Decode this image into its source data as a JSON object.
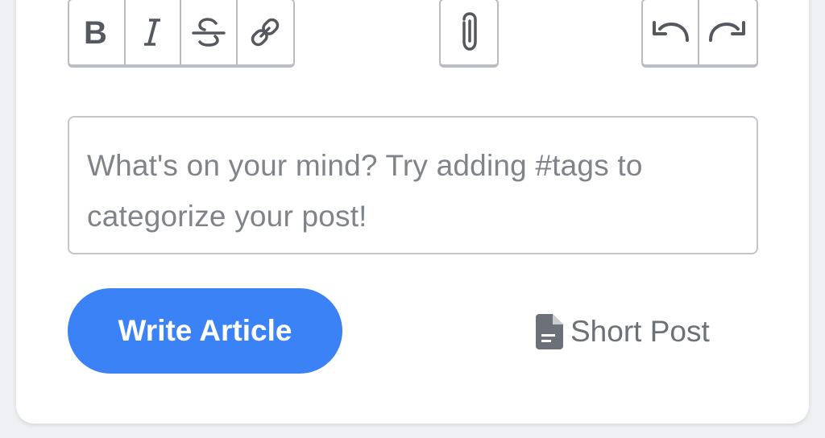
{
  "toolbar": {
    "format_buttons": [
      {
        "name": "bold-icon"
      },
      {
        "name": "italic-icon"
      },
      {
        "name": "strikethrough-icon"
      },
      {
        "name": "link-icon"
      }
    ],
    "attach": {
      "name": "paperclip-icon"
    },
    "history_buttons": [
      {
        "name": "undo-icon"
      },
      {
        "name": "redo-icon"
      }
    ]
  },
  "editor": {
    "placeholder_line1": "What's on your mind? Try adding #tags to",
    "placeholder_line2": "categorize your post!"
  },
  "actions": {
    "write_article_label": "Write Article",
    "short_post_label": "Short Post",
    "short_post_icon": "document-icon"
  },
  "colors": {
    "accent": "#3b82f6",
    "border": "#b9bcc1",
    "muted_text": "#80848a"
  }
}
